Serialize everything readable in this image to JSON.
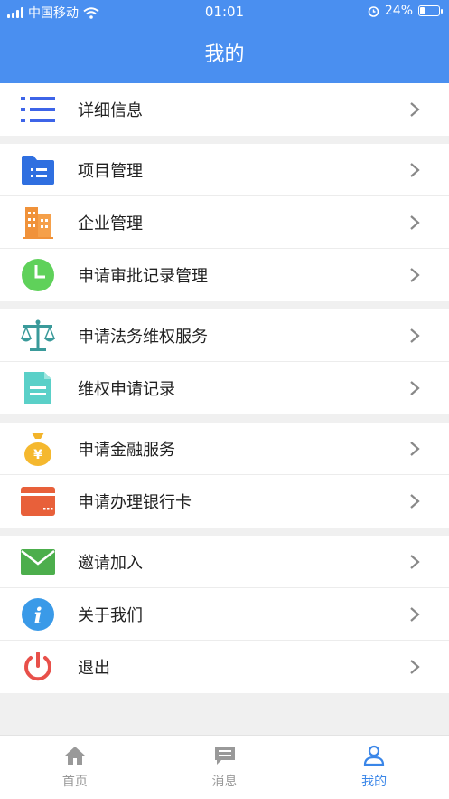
{
  "status_bar": {
    "carrier": "中国移动",
    "time": "01:01",
    "battery": "24%"
  },
  "header": {
    "title": "我的"
  },
  "groups": [
    {
      "items": [
        {
          "label": "详细信息",
          "icon": "list-icon"
        }
      ]
    },
    {
      "items": [
        {
          "label": "项目管理",
          "icon": "folder-icon"
        },
        {
          "label": "企业管理",
          "icon": "buildings-icon"
        },
        {
          "label": "申请审批记录管理",
          "icon": "clock-icon"
        }
      ]
    },
    {
      "items": [
        {
          "label": "申请法务维权服务",
          "icon": "scales-icon"
        },
        {
          "label": "维权申请记录",
          "icon": "document-icon"
        }
      ]
    },
    {
      "items": [
        {
          "label": "申请金融服务",
          "icon": "money-bag-icon"
        },
        {
          "label": "申请办理银行卡",
          "icon": "bank-card-icon"
        }
      ]
    },
    {
      "items": [
        {
          "label": "邀请加入",
          "icon": "envelope-icon"
        },
        {
          "label": "关于我们",
          "icon": "info-icon"
        },
        {
          "label": "退出",
          "icon": "power-icon"
        }
      ]
    }
  ],
  "tabbar": {
    "tabs": [
      {
        "label": "首页",
        "icon": "home-icon"
      },
      {
        "label": "消息",
        "icon": "message-icon"
      },
      {
        "label": "我的",
        "icon": "user-icon"
      }
    ],
    "active": "我的"
  },
  "colors": {
    "header_bg": "#4a8ff0",
    "active_tab": "#3a86e8"
  }
}
